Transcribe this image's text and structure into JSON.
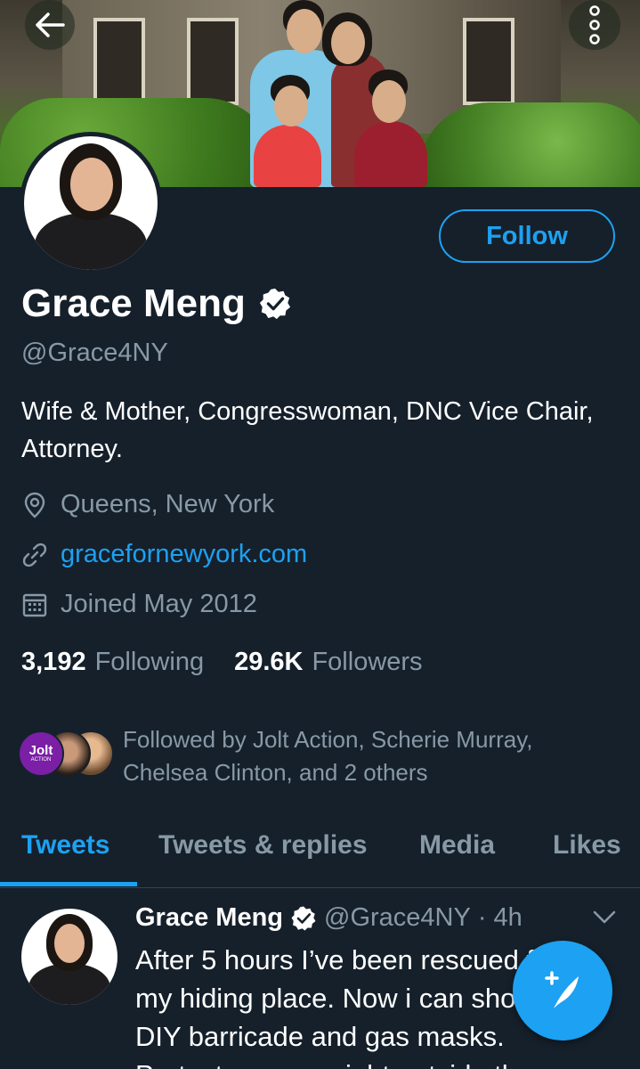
{
  "profile": {
    "name": "Grace Meng",
    "handle": "@Grace4NY",
    "bio": "Wife & Mother, Congresswoman, DNC Vice Chair, Attorney.",
    "location": "Queens, New York",
    "website": "gracefornewyork.com",
    "joined": "Joined May 2012",
    "following_count": "3,192",
    "following_label": "Following",
    "followers_count": "29.6K",
    "followers_label": "Followers",
    "followed_by": "Followed by Jolt Action, Scherie Murray, Chelsea Clinton, and 2 others",
    "mini_avatar_1_text": "Jolt",
    "mini_avatar_1_subtext": "ACTION"
  },
  "actions": {
    "follow_label": "Follow"
  },
  "tabs": [
    {
      "label": "Tweets"
    },
    {
      "label": "Tweets & replies"
    },
    {
      "label": "Media"
    },
    {
      "label": "Likes"
    }
  ],
  "tweet": {
    "name": "Grace Meng",
    "handle": "@Grace4NY",
    "time": "· 4h",
    "text": "After 5 hours I’ve been rescued from my hiding place. Now i can show my DIY barricade and gas masks. Protestors were right outside the"
  },
  "icons": {
    "back": "arrow-left-icon",
    "more": "more-vertical-icon",
    "verified": "verified-badge-icon",
    "location": "location-pin-icon",
    "link": "link-icon",
    "calendar": "calendar-icon",
    "chevron": "chevron-down-icon",
    "compose": "compose-tweet-icon"
  },
  "colors": {
    "background": "#15202b",
    "accent": "#1da1f2",
    "secondary_text": "#8899a6",
    "divider": "#38444d"
  }
}
